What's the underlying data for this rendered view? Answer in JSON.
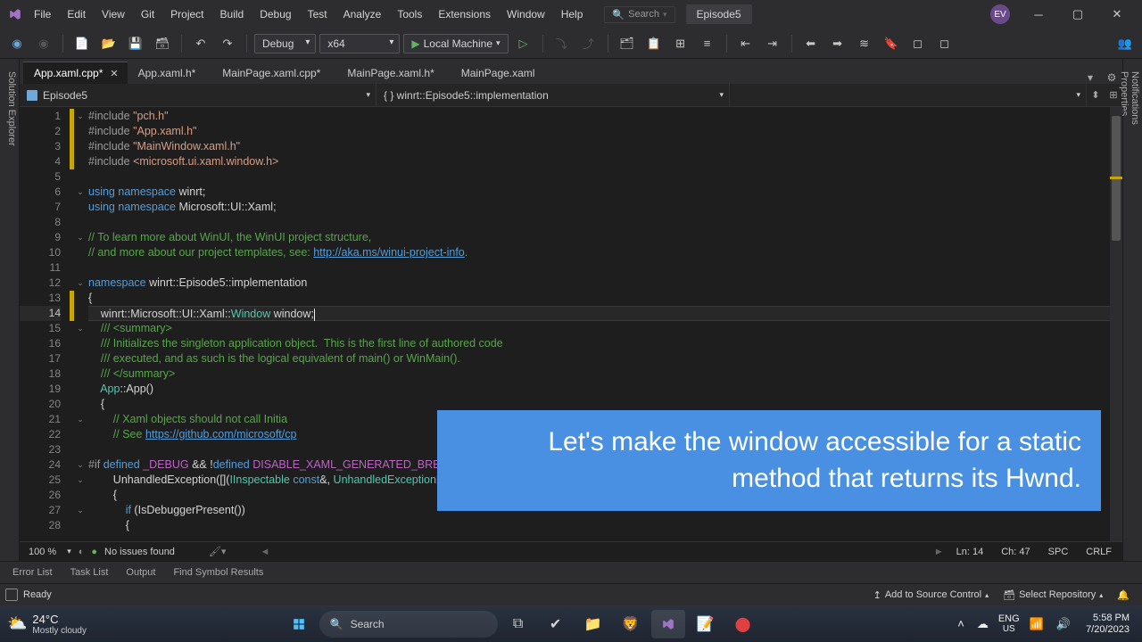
{
  "menus": [
    "File",
    "Edit",
    "View",
    "Git",
    "Project",
    "Build",
    "Debug",
    "Test",
    "Analyze",
    "Tools",
    "Extensions",
    "Window",
    "Help"
  ],
  "search_placeholder": "Search",
  "title_tab": "Episode5",
  "avatar": "EV",
  "toolbar": {
    "config": "Debug",
    "platform": "x64",
    "run_target": "Local Machine"
  },
  "tabs": [
    {
      "label": "App.xaml.cpp*",
      "active": true,
      "close": true
    },
    {
      "label": "App.xaml.h*",
      "active": false,
      "close": false
    },
    {
      "label": "MainPage.xaml.cpp*",
      "active": false,
      "close": false
    },
    {
      "label": "MainPage.xaml.h*",
      "active": false,
      "close": false
    },
    {
      "label": "MainPage.xaml",
      "active": false,
      "close": false
    }
  ],
  "nav": {
    "project": "Episode5",
    "scope": "{ } winrt::Episode5::implementation"
  },
  "side_left": [
    "Solution Explorer"
  ],
  "side_right": [
    "Notifications",
    "Properties"
  ],
  "code": [
    {
      "n": 1,
      "mod": true,
      "fold": "v",
      "html": "<span class='t-pre'>#include</span> <span class='t-str'>\"pch.h\"</span>"
    },
    {
      "n": 2,
      "mod": true,
      "html": "<span class='t-pre'>#include</span> <span class='t-str'>\"App.xaml.h\"</span>"
    },
    {
      "n": 3,
      "mod": true,
      "html": "<span class='t-pre'>#include</span> <span class='t-str'>\"MainWindow.xaml.h\"</span>"
    },
    {
      "n": 4,
      "mod": true,
      "html": "<span class='t-pre'>#include</span> <span class='t-str'>&lt;microsoft.ui.xaml.window.h&gt;</span>"
    },
    {
      "n": 5,
      "html": ""
    },
    {
      "n": 6,
      "fold": "v",
      "html": "<span class='t-kw'>using</span> <span class='t-kw'>namespace</span> <span class='t-id'>winrt</span><span class='t-pun'>;</span>"
    },
    {
      "n": 7,
      "html": "<span class='t-kw'>using</span> <span class='t-kw'>namespace</span> <span class='t-id'>Microsoft::UI::Xaml</span><span class='t-pun'>;</span>"
    },
    {
      "n": 8,
      "html": ""
    },
    {
      "n": 9,
      "fold": "v",
      "html": "<span class='t-cmt'>// To learn more about WinUI, the WinUI project structure,</span>"
    },
    {
      "n": 10,
      "html": "<span class='t-cmt'>// and more about our project templates, see: </span><span class='t-url'>http://aka.ms/winui-project-info</span><span class='t-cmt'>.</span>"
    },
    {
      "n": 11,
      "html": ""
    },
    {
      "n": 12,
      "fold": "v",
      "html": "<span class='t-kw'>namespace</span> <span class='t-id'>winrt::Episode5::implementation</span>"
    },
    {
      "n": 13,
      "mod": true,
      "html": "<span class='t-pun'>{</span>"
    },
    {
      "n": 14,
      "mod": true,
      "cursor": true,
      "html": "    <span class='t-id'>winrt::Microsoft::UI::Xaml::</span><span class='t-type'>Window</span> <span class='t-id'>window</span><span class='t-pun'>;</span><span class='caret'></span>"
    },
    {
      "n": 15,
      "fold": "v",
      "html": "    <span class='t-cmt'>/// &lt;summary&gt;</span>"
    },
    {
      "n": 16,
      "html": "    <span class='t-cmt'>/// Initializes the singleton application object.  This is the first line of authored code</span>"
    },
    {
      "n": 17,
      "html": "    <span class='t-cmt'>/// executed, and as such is the logical equivalent of main() or WinMain().</span>"
    },
    {
      "n": 18,
      "html": "    <span class='t-cmt'>/// &lt;/summary&gt;</span>"
    },
    {
      "n": 19,
      "html": "    <span class='t-type'>App</span><span class='t-pun'>::</span><span class='t-id'>App</span><span class='t-pun'>()</span>"
    },
    {
      "n": 20,
      "html": "    <span class='t-pun'>{</span>"
    },
    {
      "n": 21,
      "fold": "v",
      "html": "        <span class='t-cmt'>// Xaml objects should not call Initia</span>"
    },
    {
      "n": 22,
      "html": "        <span class='t-cmt'>// See </span><span class='t-url'>https://github.com/microsoft/cp</span>"
    },
    {
      "n": 23,
      "html": ""
    },
    {
      "n": 24,
      "fold": "v",
      "html": "<span class='t-pre'>#if</span> <span class='t-kw'>defined</span> <span class='t-def'>_DEBUG</span> <span class='t-pun'>&amp;&amp;</span> <span class='t-pun'>!</span><span class='t-kw'>defined</span> <span class='t-def'>DISABLE_XAML_GENERATED_BREAK_ON_UNHANDLED_EXCEPTION</span>"
    },
    {
      "n": 25,
      "fold": "v",
      "html": "        <span class='t-id'>UnhandledException</span><span class='t-pun'>([](</span><span class='t-type'>IInspectable</span> <span class='t-kw'>const</span><span class='t-pun'>&amp;,</span> <span class='t-type'>UnhandledExceptionEventArgs</span>"
    },
    {
      "n": 26,
      "html": "        <span class='t-pun'>{</span>"
    },
    {
      "n": 27,
      "fold": "v",
      "html": "            <span class='t-kw'>if</span> <span class='t-pun'>(</span><span class='t-id'>IsDebuggerPresent</span><span class='t-pun'>())</span>"
    },
    {
      "n": 28,
      "html": "            <span class='t-pun'>{</span>"
    }
  ],
  "footer": {
    "zoom": "100 %",
    "issues": "No issues found",
    "ln": "Ln: 14",
    "ch": "Ch: 47",
    "spc": "SPC",
    "crlf": "CRLF"
  },
  "bottom_tabs": [
    "Error List",
    "Task List",
    "Output",
    "Find Symbol Results"
  ],
  "status": {
    "ready": "Ready",
    "source_ctrl": "Add to Source Control",
    "repo": "Select Repository"
  },
  "task": {
    "temp": "24°C",
    "cond": "Mostly cloudy",
    "search": "Search",
    "lang": "ENG",
    "kb": "US",
    "time": "5:58 PM",
    "date": "7/20/2023"
  },
  "overlay": "Let's make the window accessible for a static method that returns its Hwnd."
}
